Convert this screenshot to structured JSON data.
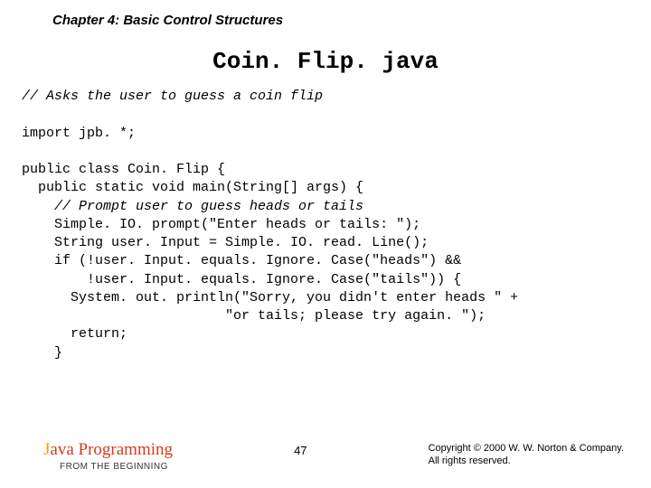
{
  "chapter": "Chapter 4: Basic Control Structures",
  "title": "Coin. Flip. java",
  "code": {
    "l1": "// Asks the user to guess a coin flip",
    "l2": "import jpb. *;",
    "l3": "public class Coin. Flip {",
    "l4": "  public static void main(String[] args) {",
    "l5": "    // Prompt user to guess heads or tails",
    "l6": "    Simple. IO. prompt(\"Enter heads or tails: \");",
    "l7": "    String user. Input = Simple. IO. read. Line();",
    "l8": "    if (!user. Input. equals. Ignore. Case(\"heads\") &&",
    "l9": "        !user. Input. equals. Ignore. Case(\"tails\")) {",
    "l10": "      System. out. println(\"Sorry, you didn't enter heads \" +",
    "l11": "                         \"or tails; please try again. \");",
    "l12": "      return;",
    "l13": "    }"
  },
  "footer": {
    "book_j": "J",
    "book_rest": "ava Programming",
    "book_sub": "FROM THE BEGINNING",
    "page": "47",
    "copyright1": "Copyright © 2000 W. W. Norton & Company.",
    "copyright2": "All rights reserved."
  }
}
